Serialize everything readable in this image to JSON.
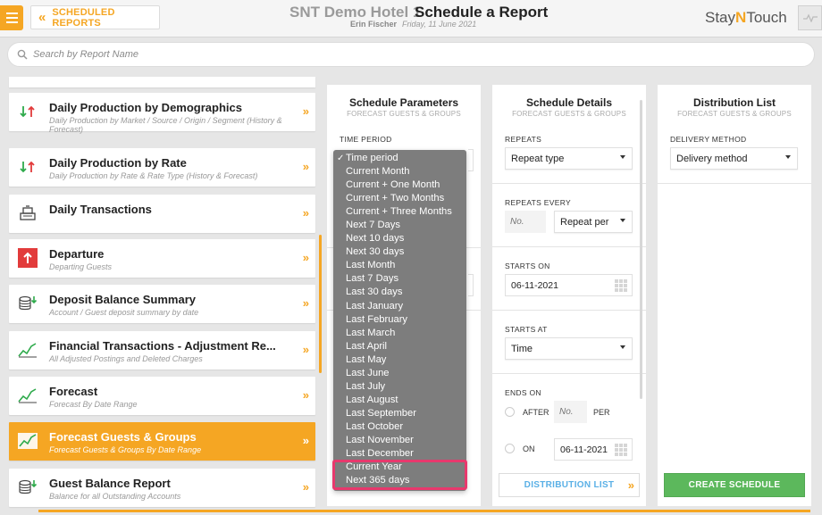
{
  "header": {
    "back_label": "SCHEDULED REPORTS",
    "hotel_name": "SNT Demo Hotel 1",
    "page_title": "Schedule a Report",
    "user_name": "Erin Fischer",
    "date": "Friday, 11 June 2021",
    "brand_part1": "Stay",
    "brand_part2": "N",
    "brand_part3": "Touch"
  },
  "search": {
    "placeholder": "Search by Report Name"
  },
  "reports": [
    {
      "title": "Daily Production by Demographics",
      "desc": "Daily Production by Market / Source / Origin / Segment (History & Forecast)",
      "icon": "up-down-arrows-icon"
    },
    {
      "title": "Daily Production by Rate",
      "desc": "Daily Production by Rate & Rate Type (History & Forecast)",
      "icon": "up-down-arrows-icon"
    },
    {
      "title": "Daily Transactions",
      "desc": "",
      "icon": "cash-register-icon"
    },
    {
      "title": "Departure",
      "desc": "Departing Guests",
      "icon": "departure-arrow-icon"
    },
    {
      "title": "Deposit Balance Summary",
      "desc": "Account / Guest deposit summary by date",
      "icon": "coin-stack-icon"
    },
    {
      "title": "Financial Transactions - Adjustment Re...",
      "desc": "All Adjusted Postings and Deleted Charges",
      "icon": "trend-chart-icon"
    },
    {
      "title": "Forecast",
      "desc": "Forecast By Date Range",
      "icon": "trend-chart-icon"
    },
    {
      "title": "Forecast Guests & Groups",
      "desc": "Forecast Guests & Groups By Date Range",
      "icon": "trend-chart-icon",
      "active": true
    },
    {
      "title": "Guest Balance Report",
      "desc": "Balance for all Outstanding Accounts",
      "icon": "coin-stack-icon"
    }
  ],
  "schedule_parameters": {
    "title": "Schedule Parameters",
    "subtitle": "FORECAST GUESTS & GROUPS",
    "time_period_label": "TIME PERIOD"
  },
  "time_period_options": [
    "Time period",
    "Current Month",
    "Current + One Month",
    "Current + Two Months",
    "Current + Three Months",
    "Next 7 Days",
    "Next 10 days",
    "Next 30 days",
    "Last Month",
    "Last 7 Days",
    "Last 30 days",
    "Last January",
    "Last February",
    "Last March",
    "Last April",
    "Last May",
    "Last June",
    "Last July",
    "Last August",
    "Last September",
    "Last October",
    "Last November",
    "Last December",
    "Current Year",
    "Next 365 days"
  ],
  "schedule_details": {
    "title": "Schedule Details",
    "subtitle": "FORECAST GUESTS & GROUPS",
    "repeats_label": "REPEATS",
    "repeats_value": "Repeat type",
    "repeats_every_label": "REPEATS EVERY",
    "repeats_every_placeholder": "No.",
    "repeat_per_value": "Repeat per",
    "starts_on_label": "STARTS ON",
    "starts_on_value": "06-11-2021",
    "starts_at_label": "STARTS AT",
    "starts_at_value": "Time",
    "ends_on_label": "ENDS ON",
    "after_label": "AFTER",
    "after_placeholder": "No.",
    "per_label": "PER",
    "on_label": "ON",
    "on_value": "06-11-2021",
    "distribution_list_button": "DISTRIBUTION LIST"
  },
  "distribution_list": {
    "title": "Distribution List",
    "subtitle": "FORECAST GUESTS & GROUPS",
    "delivery_method_label": "DELIVERY METHOD",
    "delivery_method_value": "Delivery method",
    "create_button": "CREATE SCHEDULE"
  },
  "colors": {
    "accent": "#f5a623",
    "green": "#5cb85c",
    "highlight": "#e8386d"
  }
}
